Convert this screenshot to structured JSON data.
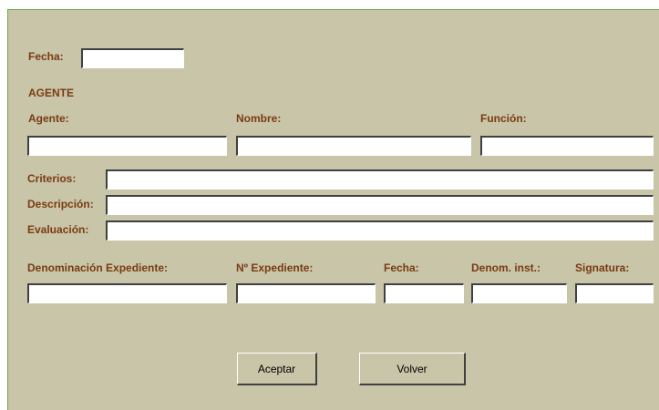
{
  "form": {
    "fecha_label": "Fecha:",
    "fecha_value": "",
    "section_title": "AGENTE",
    "agente_label": "Agente:",
    "agente_value": "",
    "nombre_label": "Nombre:",
    "nombre_value": "",
    "funcion_label": "Función:",
    "funcion_value": "",
    "criterios_label": "Criterios:",
    "criterios_value": "",
    "descripcion_label": "Descripción:",
    "descripcion_value": "",
    "evaluacion_label": "Evaluación:",
    "evaluacion_value": "",
    "denominacion_expediente_label": "Denominación Expediente:",
    "denominacion_expediente_value": "",
    "n_expediente_label": "Nº Expediente:",
    "n_expediente_value": "",
    "fecha2_label": "Fecha:",
    "fecha2_value": "",
    "denom_inst_label": "Denom. inst.:",
    "denom_inst_value": "",
    "signatura_label": "Signatura:",
    "signatura_value": ""
  },
  "buttons": {
    "aceptar_label": "Aceptar",
    "volver_label": "Volver"
  },
  "colors": {
    "panel_bg": "#c8c5a8",
    "label_text": "#7a3b12",
    "panel_border": "#6aa84f"
  }
}
